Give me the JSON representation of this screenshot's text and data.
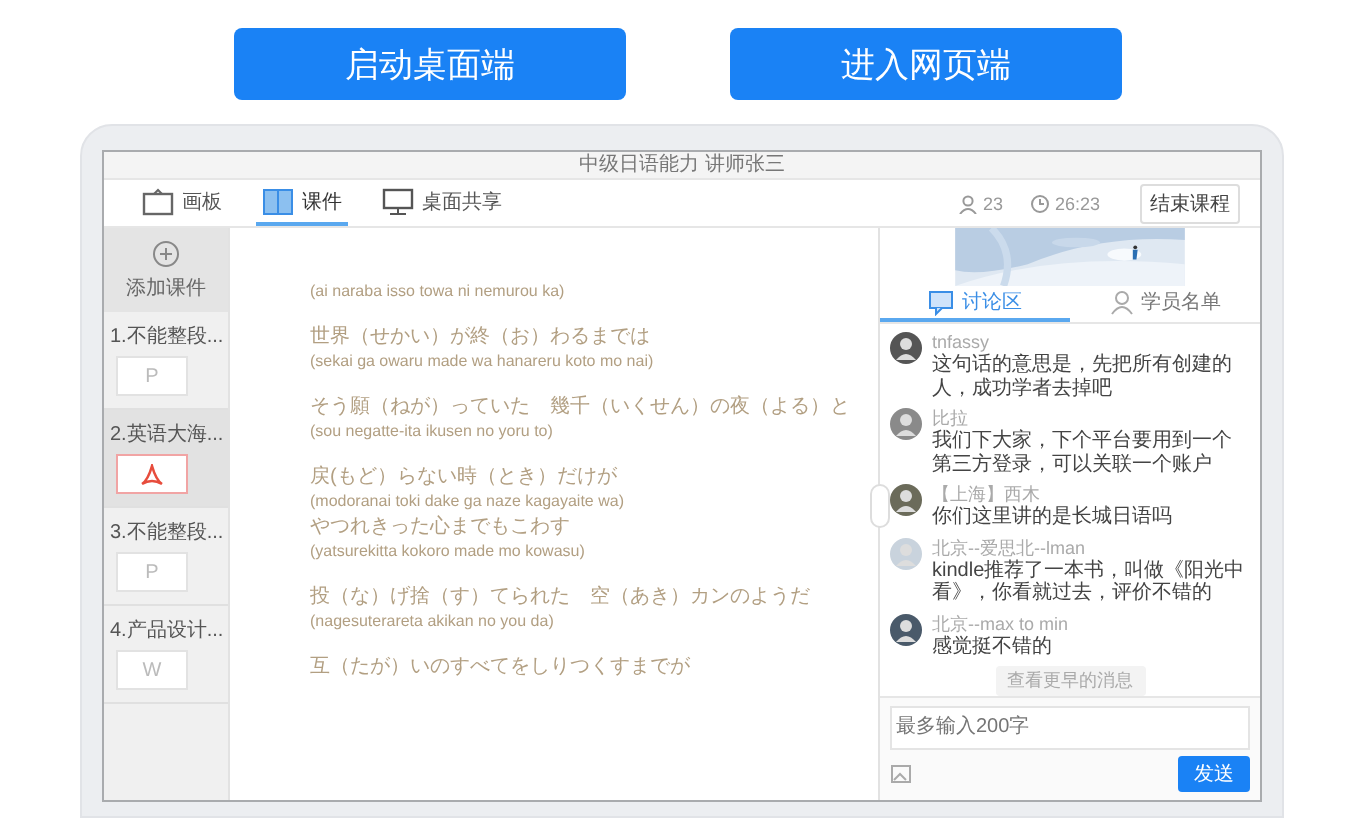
{
  "buttons": [
    {
      "label": "启动桌面端"
    },
    {
      "label": "进入网页端"
    }
  ],
  "app": {
    "title": "中级日语能力 讲师张三",
    "toolbar": {
      "tabs": [
        {
          "label": "画板",
          "kind": "board",
          "selected": false
        },
        {
          "label": "课件",
          "kind": "book",
          "selected": true
        },
        {
          "label": "桌面共享",
          "kind": "monitor",
          "selected": false
        }
      ],
      "stats": [
        {
          "kind": "people",
          "text": "23"
        },
        {
          "kind": "clock",
          "text": "26:23"
        }
      ],
      "end_button": "结束课程"
    },
    "sidebar": {
      "add_label": "添加课件",
      "items": [
        {
          "label": "1.不能整段...",
          "kind": "ppt",
          "letter": "P",
          "selected": false
        },
        {
          "label": "2.英语大海...",
          "kind": "pdf",
          "selected": true
        },
        {
          "label": "3.不能整段...",
          "kind": "ppt",
          "letter": "P",
          "selected": false
        },
        {
          "label": "4.产品设计...",
          "kind": "doc",
          "letter": "W",
          "selected": false
        }
      ]
    },
    "lyrics": [
      [
        {
          "kind": "romaji",
          "text": "(ai naraba isso towa ni nemurou ka)"
        }
      ],
      [
        {
          "kind": "japanese",
          "text": "世界（せかい）が終（お）わるまでは"
        },
        {
          "kind": "romaji",
          "text": "(sekai ga owaru made wa hanareru koto mo nai)"
        }
      ],
      [
        {
          "kind": "japanese",
          "text": "そう願（ねが）っていた　幾千（いくせん）の夜（よる）と"
        },
        {
          "kind": "romaji",
          "text": "(sou negatte-ita ikusen no yoru to)"
        }
      ],
      [
        {
          "kind": "japanese",
          "text": "戻(もど）らない時（とき）だけが"
        },
        {
          "kind": "romaji",
          "text": "(modoranai toki dake ga naze kagayaite wa)"
        },
        {
          "kind": "japanese",
          "text": "やつれきった心までもこわす"
        },
        {
          "kind": "romaji",
          "text": "(yatsurekitta kokoro made mo kowasu)"
        }
      ],
      [
        {
          "kind": "japanese",
          "text": "投（な）げ捨（す）てられた　空（あき）カンのようだ"
        },
        {
          "kind": "romaji",
          "text": "(nagesuterareta akikan no you da)"
        }
      ],
      [
        {
          "kind": "japanese",
          "text": "互（たが）いのすべてをしりつくすまでが"
        }
      ]
    ],
    "chat": {
      "tabs": [
        {
          "label": "讨论区",
          "kind": "chat",
          "selected": true
        },
        {
          "label": "学员名单",
          "kind": "person",
          "selected": false
        }
      ],
      "messages": [
        {
          "name": "tnfassy",
          "text": "这句话的意思是，先把所有创建的人，成功学者去掉吧"
        },
        {
          "name": "比拉",
          "text": "我们下大家，下个平台要用到一个第三方登录，可以关联一个账户"
        },
        {
          "name": "【上海】西木",
          "text": "你们这里讲的是长城日语吗"
        },
        {
          "name": "北京--爱思北--lman",
          "text": "kindle推荐了一本书，叫做《阳光中看》，你看就过去，评价不错的"
        },
        {
          "name": "北京--max to min",
          "text": "感觉挺不错的"
        }
      ],
      "more": "查看更早的消息",
      "input": {
        "placeholder": "最多输入200字"
      },
      "send": "发送"
    }
  }
}
